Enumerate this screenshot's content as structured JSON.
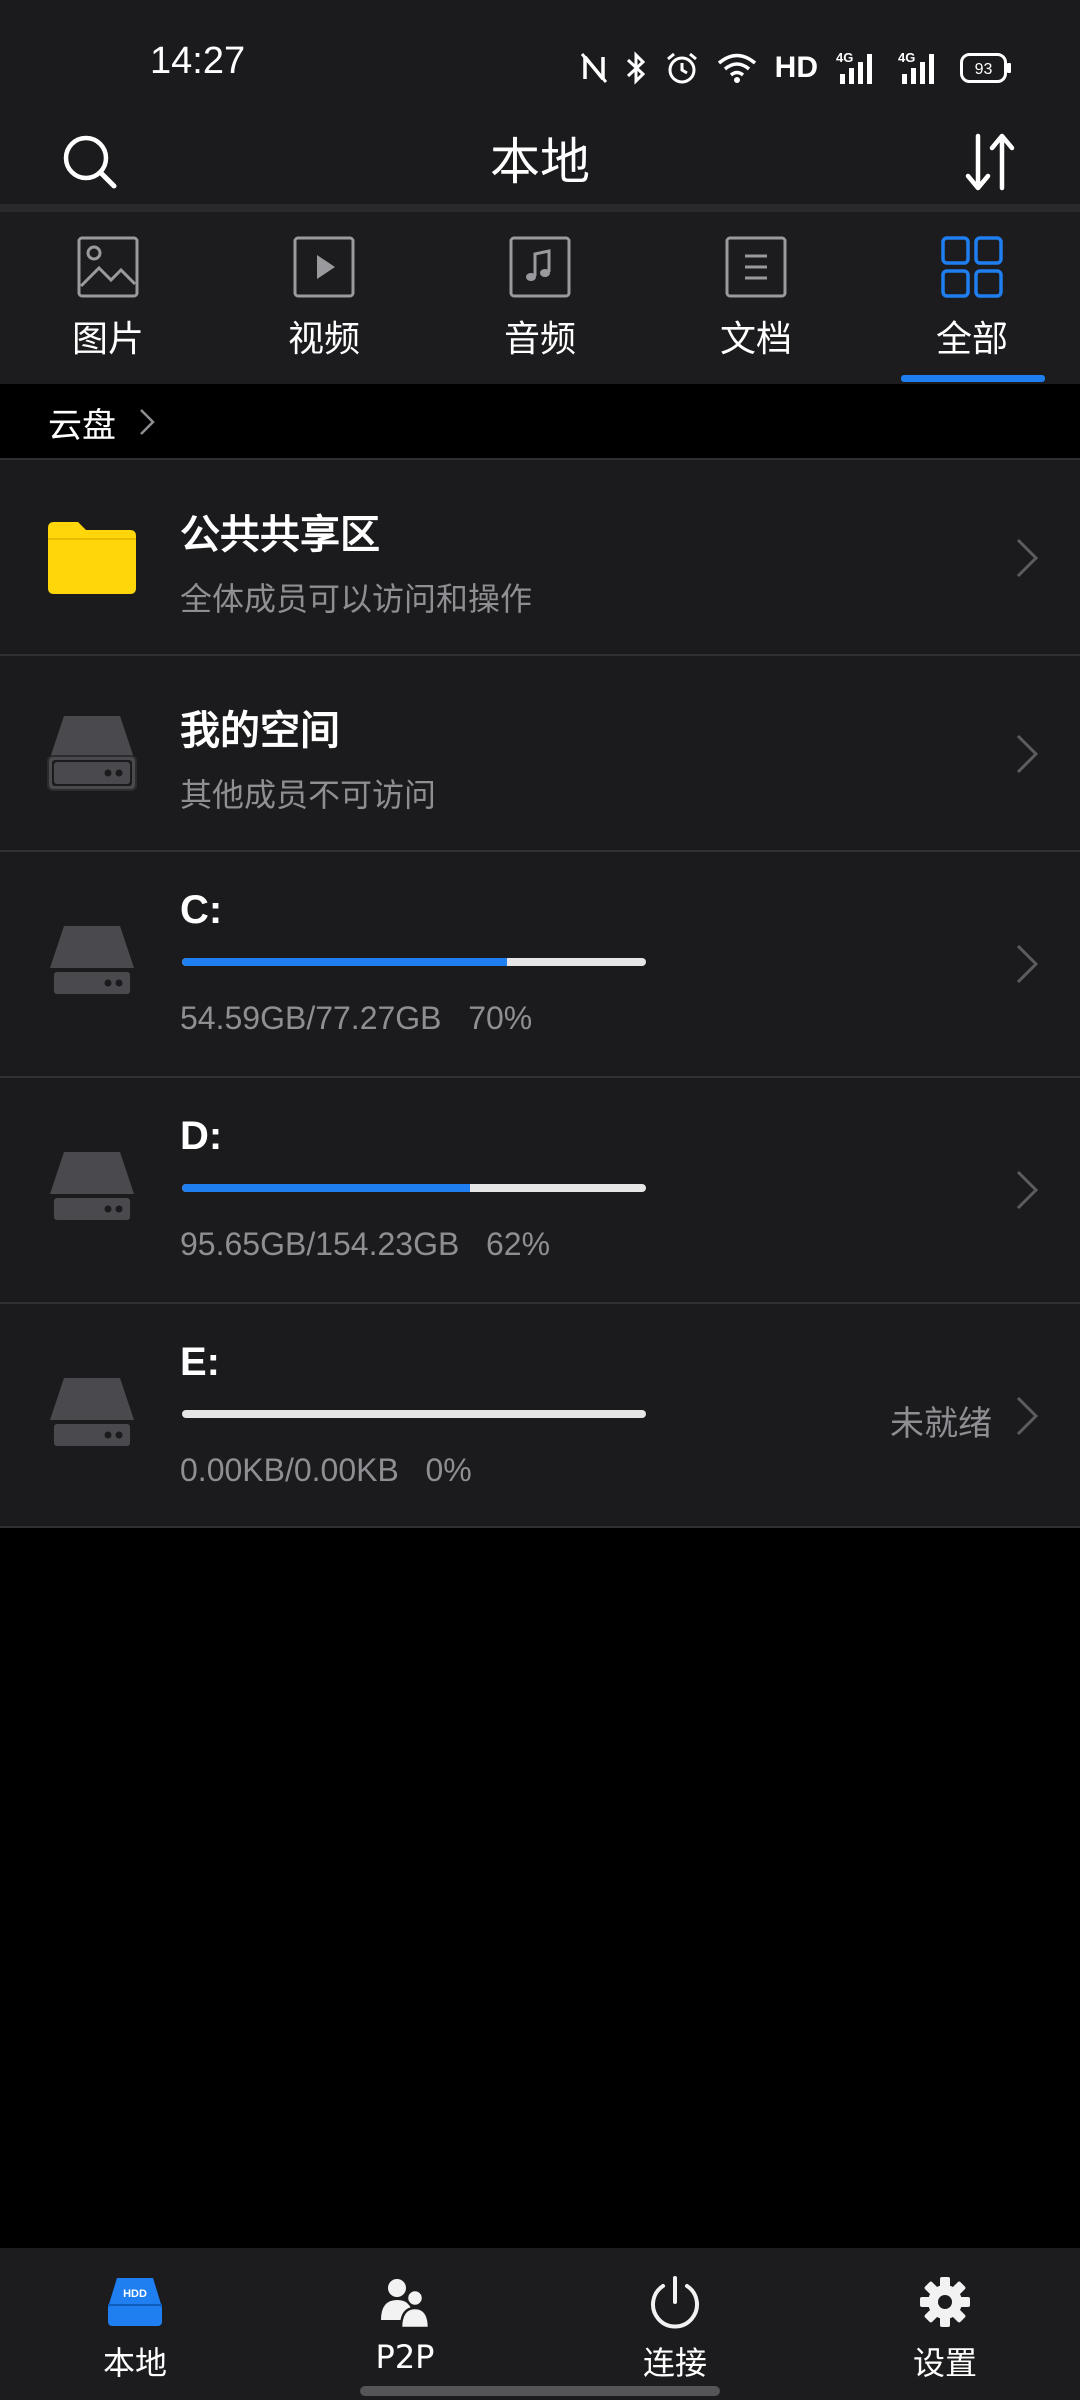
{
  "status_bar": {
    "time": "14:27",
    "hd_label": "HD",
    "battery": "93",
    "icons": [
      "nfc-icon",
      "bluetooth-icon",
      "alarm-icon",
      "wifi-icon",
      "signal-4g-icon",
      "signal-4g-icon",
      "battery-icon"
    ]
  },
  "header": {
    "title": "本地",
    "search_icon": "search-icon",
    "sort_icon": "sort-icon"
  },
  "tabs": [
    {
      "label": "图片",
      "icon": "image-icon",
      "active": false
    },
    {
      "label": "视频",
      "icon": "video-icon",
      "active": false
    },
    {
      "label": "音频",
      "icon": "audio-icon",
      "active": false
    },
    {
      "label": "文档",
      "icon": "document-icon",
      "active": false
    },
    {
      "label": "全部",
      "icon": "grid-icon",
      "active": true
    }
  ],
  "breadcrumb": {
    "label": "云盘"
  },
  "items": {
    "public": {
      "title": "公共共享区",
      "subtitle": "全体成员可以访问和操作"
    },
    "my_space": {
      "title": "我的空间",
      "subtitle": "其他成员不可访问"
    },
    "drives": [
      {
        "name": "C:",
        "used": "54.59GB",
        "total": "77.27GB",
        "usage_text": "54.59GB/77.27GB   70%",
        "percent": 70,
        "status": ""
      },
      {
        "name": "D:",
        "used": "95.65GB",
        "total": "154.23GB",
        "usage_text": "95.65GB/154.23GB   62%",
        "percent": 62,
        "status": ""
      },
      {
        "name": "E:",
        "used": "0.00KB",
        "total": "0.00KB",
        "usage_text": "0.00KB/0.00KB   0%",
        "percent": 0,
        "status": "未就绪"
      }
    ]
  },
  "bottom_nav": [
    {
      "label": "本地",
      "icon": "hdd-icon",
      "active": true
    },
    {
      "label": "P2P",
      "icon": "users-icon",
      "active": false
    },
    {
      "label": "连接",
      "icon": "power-icon",
      "active": false
    },
    {
      "label": "设置",
      "icon": "gear-icon",
      "active": false
    }
  ],
  "colors": {
    "accent": "#1f7ef0",
    "folder": "#ffd60a",
    "background": "#000000",
    "surface": "#1b1b1d",
    "secondary_text": "#8e8e93"
  }
}
